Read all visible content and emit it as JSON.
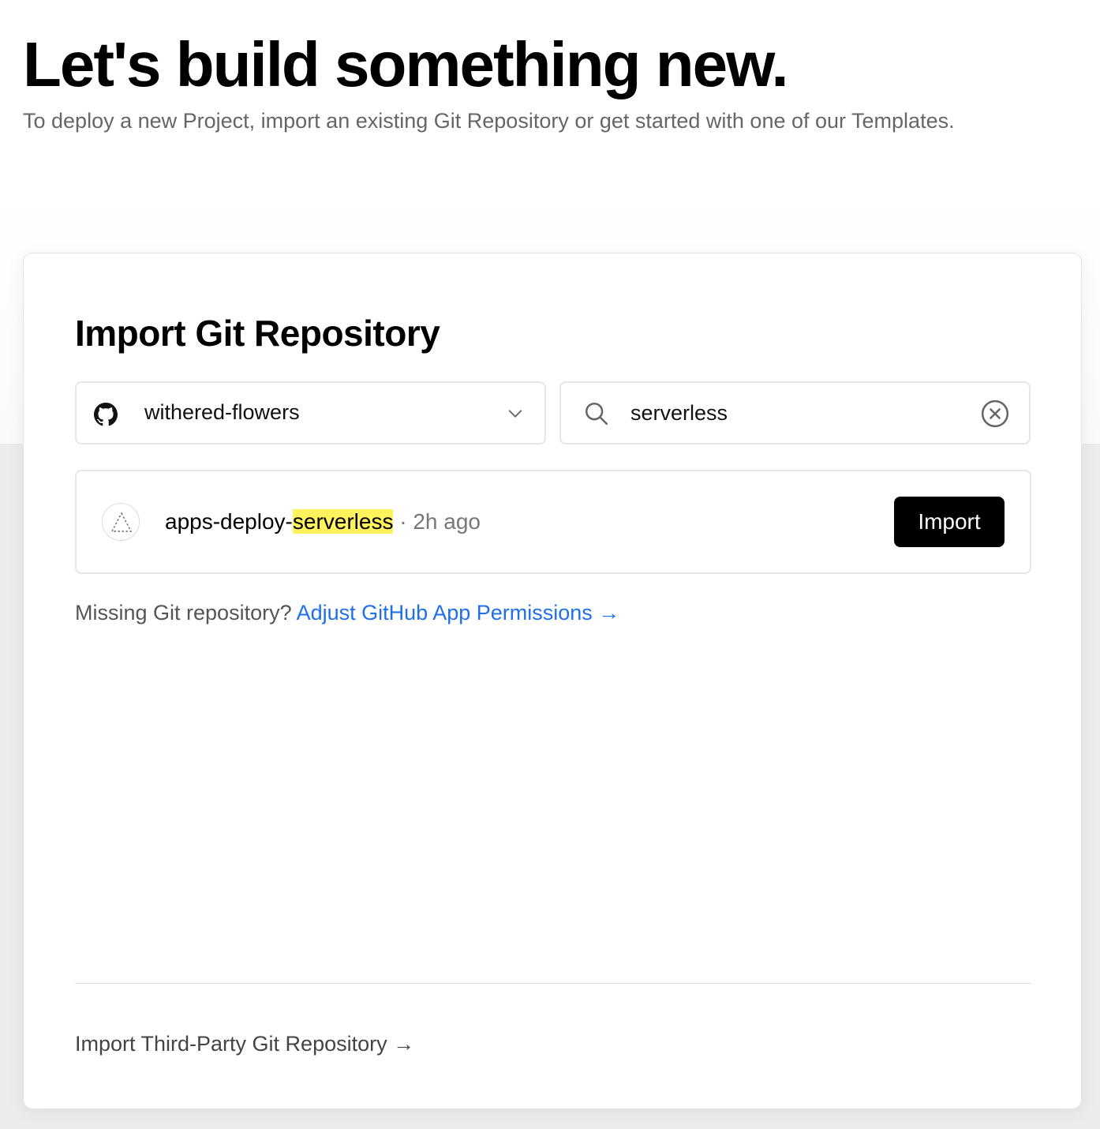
{
  "hero": {
    "title": "Let's build something new.",
    "subtitle": "To deploy a new Project, import an existing Git Repository or get started with one of our Templates."
  },
  "import_card": {
    "title": "Import Git Repository",
    "account_selector": {
      "value": "withered-flowers",
      "icon": "github-icon"
    },
    "search": {
      "value": "serverless",
      "icon": "search-icon",
      "clear_icon": "clear-icon"
    },
    "repositories": [
      {
        "name_prefix": "apps-deploy-",
        "name_match": "serverless",
        "meta": " · 2h ago",
        "icon": "triangle-icon",
        "button_label": "Import"
      }
    ],
    "missing_text": "Missing Git repository? ",
    "missing_link": "Adjust GitHub App Permissions →",
    "third_party_link": "Import Third-Party Git Repository →"
  },
  "colors": {
    "link": "#1f6feb",
    "highlight": "#fff25c",
    "button_bg": "#000000"
  }
}
